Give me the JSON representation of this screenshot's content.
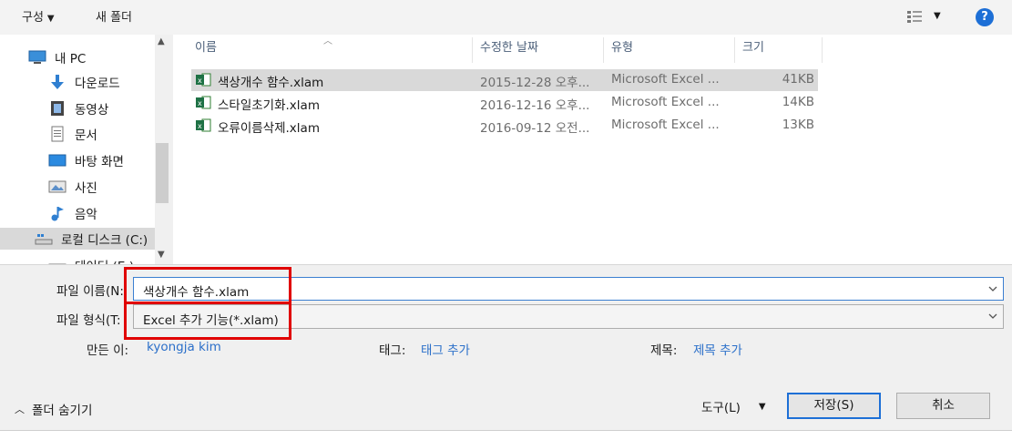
{
  "toolbar": {
    "organize": "구성",
    "new_folder": "새 폴더"
  },
  "nav": {
    "items": [
      {
        "label": "내 PC",
        "icon": "pc-icon"
      },
      {
        "label": "다운로드",
        "icon": "download-icon"
      },
      {
        "label": "동영상",
        "icon": "video-icon"
      },
      {
        "label": "문서",
        "icon": "document-icon"
      },
      {
        "label": "바탕 화면",
        "icon": "desktop-icon"
      },
      {
        "label": "사진",
        "icon": "pictures-icon"
      },
      {
        "label": "음악",
        "icon": "music-icon"
      },
      {
        "label": "로컬 디스크 (C:)",
        "icon": "local-disk-icon"
      },
      {
        "label": "데이터 (E:)",
        "icon": "drive-icon"
      }
    ]
  },
  "columns": {
    "name": "이름",
    "modified": "수정한 날짜",
    "type": "유형",
    "size": "크기"
  },
  "files": [
    {
      "name": "색상개수 함수.xlam",
      "modified": "2015-12-28 오후...",
      "type": "Microsoft Excel ...",
      "size": "41KB"
    },
    {
      "name": "스타일초기화.xlam",
      "modified": "2016-12-16 오후...",
      "type": "Microsoft Excel ...",
      "size": "14KB"
    },
    {
      "name": "오류이름삭제.xlam",
      "modified": "2016-09-12 오전...",
      "type": "Microsoft Excel ...",
      "size": "13KB"
    }
  ],
  "form": {
    "filename_label": "파일 이름(N:",
    "filename_value": "색상개수 함수.xlam",
    "filetype_label": "파일 형식(T:",
    "filetype_value": "Excel 추가 기능(*.xlam)",
    "author_label": "만든 이:",
    "author_value": "kyongja kim",
    "tags_label": "태그:",
    "tags_value": "태그 추가",
    "title_label": "제목:",
    "title_value": "제목 추가"
  },
  "footer": {
    "hide_folders": "폴더 숨기기",
    "tools": "도구(L)",
    "save": "저장(S)",
    "cancel": "취소"
  },
  "colors": {
    "accent": "#1d6fd6",
    "highlight_box": "#e00000",
    "link": "#2a6fc9",
    "selection": "#d9d9d9"
  }
}
